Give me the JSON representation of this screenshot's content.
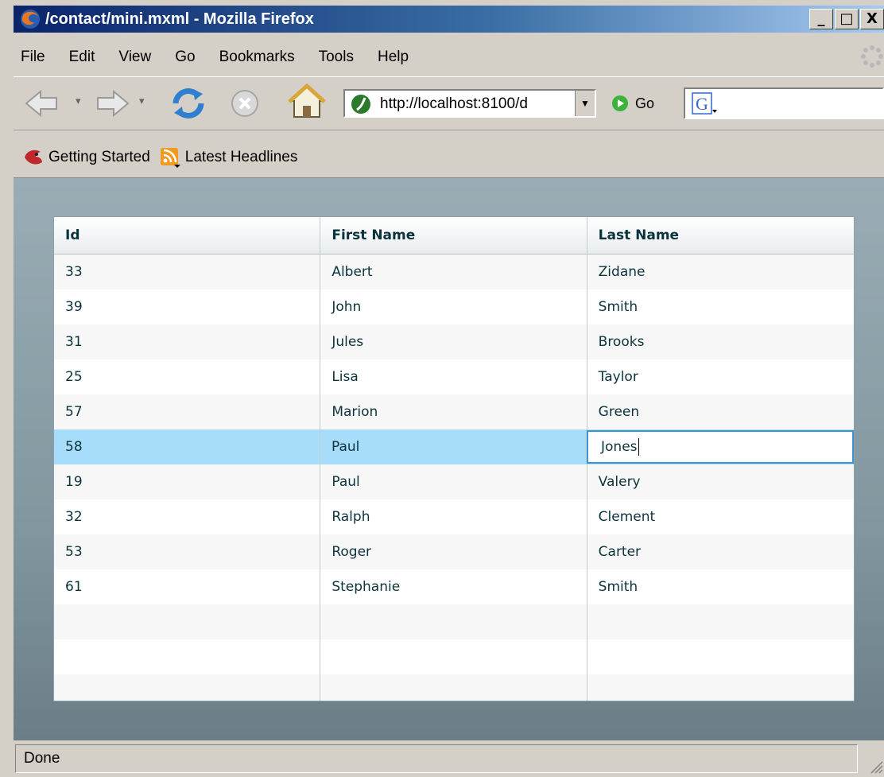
{
  "window": {
    "title": "/contact/mini.mxml - Mozilla Firefox",
    "minimize": "_",
    "maximize": "□",
    "close": "X"
  },
  "menu": [
    "File",
    "Edit",
    "View",
    "Go",
    "Bookmarks",
    "Tools",
    "Help"
  ],
  "navbar": {
    "url": "http://localhost:8100/d",
    "go_label": "Go"
  },
  "bookmarks": [
    {
      "label": "Getting Started",
      "icon": "firefox-bookmark-icon"
    },
    {
      "label": "Latest Headlines",
      "icon": "rss-feed-icon"
    }
  ],
  "grid": {
    "columns": [
      "Id",
      "First Name",
      "Last Name"
    ],
    "rows": [
      [
        "33",
        "Albert",
        "Zidane"
      ],
      [
        "39",
        "John",
        "Smith"
      ],
      [
        "31",
        "Jules",
        "Brooks"
      ],
      [
        "25",
        "Lisa",
        "Taylor"
      ],
      [
        "57",
        "Marion",
        "Green"
      ],
      [
        "58",
        "Paul",
        "Jones"
      ],
      [
        "19",
        "Paul",
        "Valery"
      ],
      [
        "32",
        "Ralph",
        "Clement"
      ],
      [
        "53",
        "Roger",
        "Carter"
      ],
      [
        "61",
        "Stephanie",
        "Smith"
      ]
    ],
    "selected_row": 5,
    "editing_value": "Jones"
  },
  "status": "Done",
  "colors": {
    "selected_row": "#a7dcfb",
    "edit_border": "#3b94d4",
    "title_bar": "#0a246a"
  }
}
